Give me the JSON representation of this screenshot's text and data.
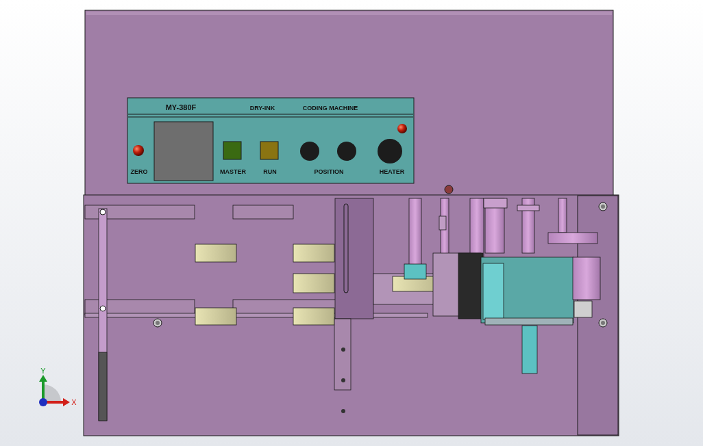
{
  "viewport": {
    "panel": {
      "model": "MY-380F",
      "type": "DRY-INK",
      "title": "CODING MACHINE",
      "controls": [
        {
          "kind": "lamp",
          "label": "ZERO"
        },
        {
          "kind": "display"
        },
        {
          "kind": "button",
          "label": "MASTER",
          "color": "#3a6a12"
        },
        {
          "kind": "button",
          "label": "RUN",
          "color": "#8a7412"
        },
        {
          "kind": "knob-pair",
          "label": "POSITION"
        },
        {
          "kind": "knob",
          "label": "HEATER"
        }
      ]
    },
    "triad": {
      "x_label": "X",
      "y_label": "Y"
    }
  }
}
